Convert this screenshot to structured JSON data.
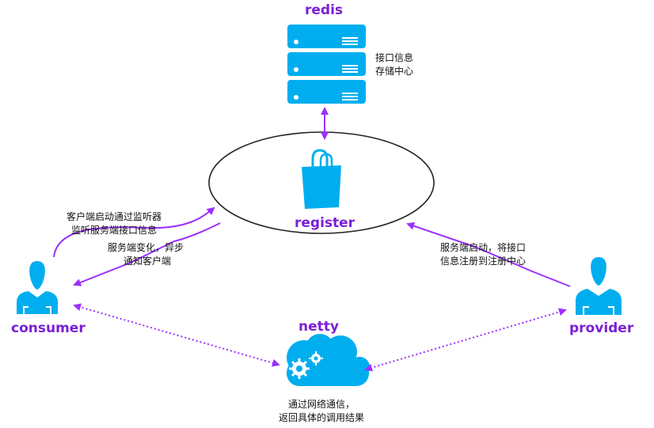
{
  "colors": {
    "accent": "#00AEEF",
    "arrow": "#9B30FF",
    "title": "#7A1FD6",
    "ellipse_stroke": "#222222"
  },
  "nodes": {
    "redis": {
      "title": "redis",
      "note_line1": "接口信息",
      "note_line2": "存储中心",
      "icon": "server-stack-icon"
    },
    "register": {
      "title": "register",
      "icon": "shopping-bag-icon"
    },
    "consumer": {
      "title": "consumer",
      "icon": "user-icon"
    },
    "provider": {
      "title": "provider",
      "icon": "user-icon"
    },
    "netty": {
      "title": "netty",
      "icon": "cloud-gears-icon",
      "note_line1": "通过网络通信，",
      "note_line2": "返回具体的调用结果"
    }
  },
  "edges": {
    "consumer_listen": {
      "line1": "客户端启动通过监听器",
      "line2": "监听服务端接口信息"
    },
    "notify_consumer": {
      "line1": "服务端变化，异步",
      "line2": "通知客户端"
    },
    "provider_register": {
      "line1": "服务端启动，将接口",
      "line2": "信息注册到注册中心"
    }
  }
}
